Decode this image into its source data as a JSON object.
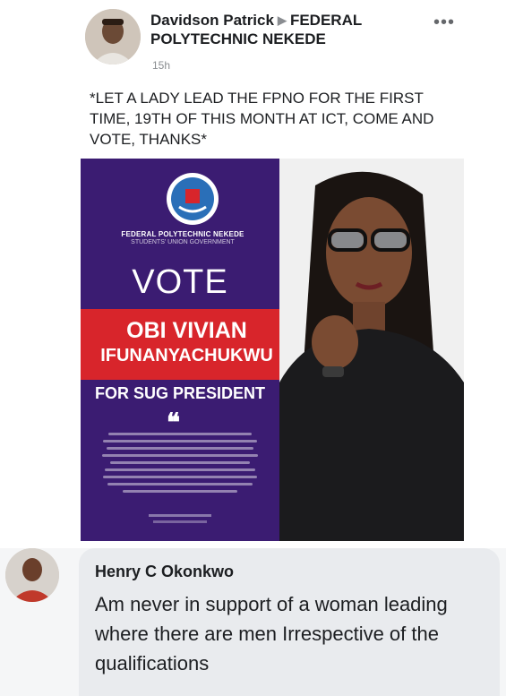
{
  "post": {
    "author": "Davidson Patrick",
    "separator_icon": "triangle-right-icon",
    "group": "FEDERAL POLYTECHNIC NEKEDE",
    "time": "15h",
    "more_icon": "more-options-icon",
    "more_glyph": "•••",
    "text": "*LET A LADY LEAD THE FPNO FOR THE FIRST TIME, 19TH OF THIS MONTH AT ICT, COME AND VOTE, THANKS*"
  },
  "poster": {
    "org_line1": "FEDERAL POLYTECHNIC NEKEDE",
    "org_line2": "STUDENTS' UNION GOVERNMENT",
    "vote": "VOTE",
    "name_line1": "OBI VIVIAN",
    "name_line2": "IFUNANYACHUKWU",
    "role": "FOR SUG PRESIDENT",
    "quote_glyph": "❝",
    "colors": {
      "panel": "#3b1c72",
      "name_box": "#d8252b"
    }
  },
  "comment": {
    "author": "Henry C Okonkwo",
    "text": "Am never in support of a woman leading where there are men Irrespective of the qualifications"
  }
}
